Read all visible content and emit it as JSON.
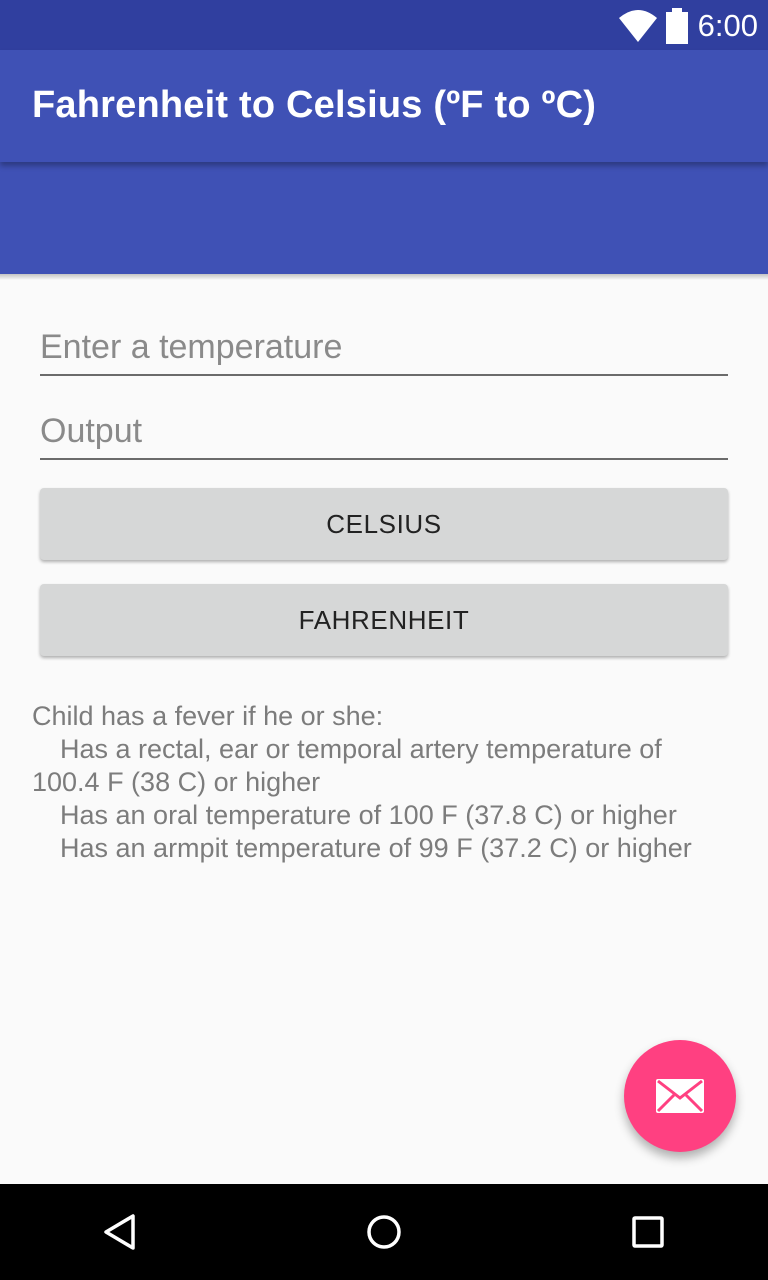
{
  "status_bar": {
    "time": "6:00",
    "icons": [
      "wifi-icon",
      "battery-icon"
    ]
  },
  "app_bar": {
    "title": "Fahrenheit to Celsius (ºF to ºC)"
  },
  "form": {
    "temperature_placeholder": "Enter a temperature",
    "output_placeholder": "Output"
  },
  "buttons": {
    "celsius_label": "CELSIUS",
    "fahrenheit_label": "FAHRENHEIT"
  },
  "info": {
    "intro": "Child has a fever if he or she:",
    "line1": "Has a rectal, ear or temporal artery temperature of",
    "line1_cont": "100.4 F (38 C) or higher",
    "line2": "Has an oral temperature of 100 F (37.8 C) or higher",
    "line3": "Has an armpit temperature of 99 F (37.2 C) or higher"
  },
  "fab": {
    "icon": "email-icon"
  },
  "nav_bar": {
    "icons": [
      "back-icon",
      "home-icon",
      "recents-icon"
    ]
  },
  "colors": {
    "status_bar": "#303f9f",
    "primary": "#3f51b5",
    "accent": "#ff4081",
    "button": "#d6d7d7",
    "background": "#fafafa"
  }
}
